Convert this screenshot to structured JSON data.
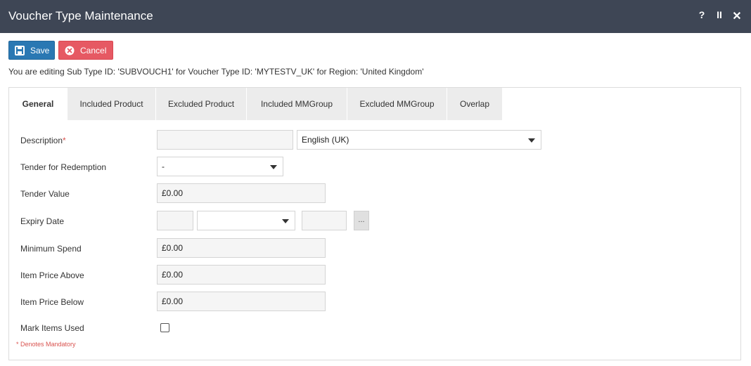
{
  "window": {
    "title": "Voucher Type Maintenance",
    "help": "?",
    "pause": "II",
    "close": "✕"
  },
  "toolbar": {
    "save_label": "Save",
    "cancel_label": "Cancel"
  },
  "info_text": "You are editing Sub Type ID: 'SUBVOUCH1' for Voucher Type ID: 'MYTESTV_UK' for Region: 'United Kingdom'",
  "tabs": [
    {
      "label": "General",
      "active": true
    },
    {
      "label": "Included Product"
    },
    {
      "label": "Excluded Product"
    },
    {
      "label": "Included MMGroup"
    },
    {
      "label": "Excluded MMGroup"
    },
    {
      "label": "Overlap"
    }
  ],
  "form": {
    "description": {
      "label": "Description",
      "required_mark": "*",
      "value": "",
      "language": "English (UK)"
    },
    "tender_for_redemption": {
      "label": "Tender for Redemption",
      "value": "-"
    },
    "tender_value": {
      "label": "Tender Value",
      "value": "£0.00"
    },
    "expiry_date": {
      "label": "Expiry Date",
      "day": "",
      "month": "",
      "year": "",
      "picker_label": "..."
    },
    "minimum_spend": {
      "label": "Minimum Spend",
      "value": "£0.00"
    },
    "item_price_above": {
      "label": "Item Price Above",
      "value": "£0.00"
    },
    "item_price_below": {
      "label": "Item Price Below",
      "value": "£0.00"
    },
    "mark_items_used": {
      "label": "Mark Items Used",
      "checked": false
    }
  },
  "footnote": "* Denotes Mandatory",
  "colors": {
    "titlebar": "#3e4655",
    "save_button": "#2a78b3",
    "cancel_button": "#e65963",
    "required": "#d9534f"
  }
}
